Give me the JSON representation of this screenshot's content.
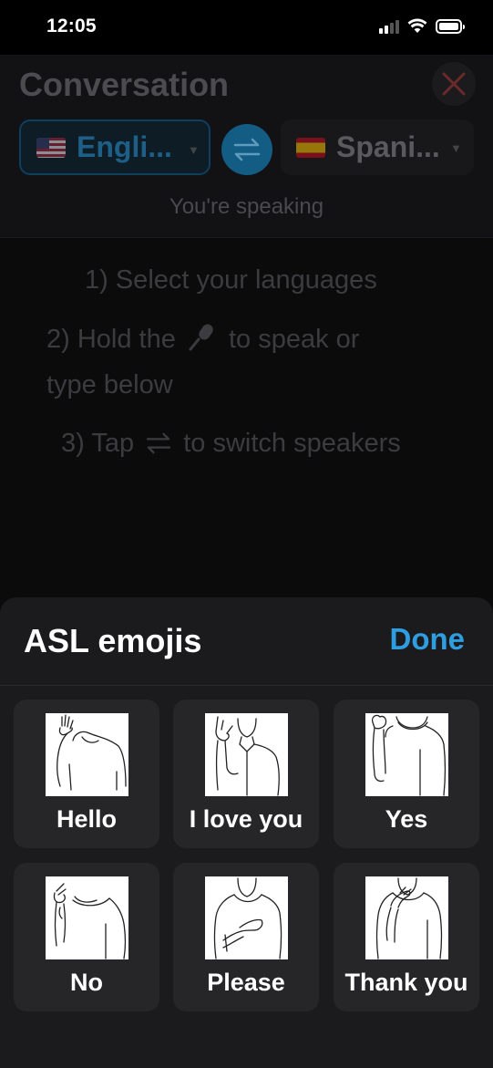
{
  "status_bar": {
    "time": "12:05"
  },
  "header": {
    "title": "Conversation",
    "source_language": {
      "label": "Engli...",
      "flag": "us-flag"
    },
    "target_language": {
      "label": "Spani...",
      "flag": "es-flag"
    },
    "speaking_status": "You're speaking"
  },
  "instructions": {
    "step1": "1) Select your languages",
    "step2_line1_prefix": "2) Hold the",
    "step2_line1_suffix": "to speak or",
    "step2_line2": "type below",
    "step3_prefix": "3) Tap",
    "step3_suffix": "to switch speakers"
  },
  "sheet": {
    "title": "ASL emojis",
    "done_label": "Done",
    "signs": [
      {
        "label": "Hello"
      },
      {
        "label": "I love you"
      },
      {
        "label": "Yes"
      },
      {
        "label": "No"
      },
      {
        "label": "Please"
      },
      {
        "label": "Thank you"
      }
    ]
  },
  "colors": {
    "accent": "#2f9ee0",
    "close": "#b23a3a",
    "sheet_background": "#1b1b1d",
    "tile_background": "#262628"
  }
}
